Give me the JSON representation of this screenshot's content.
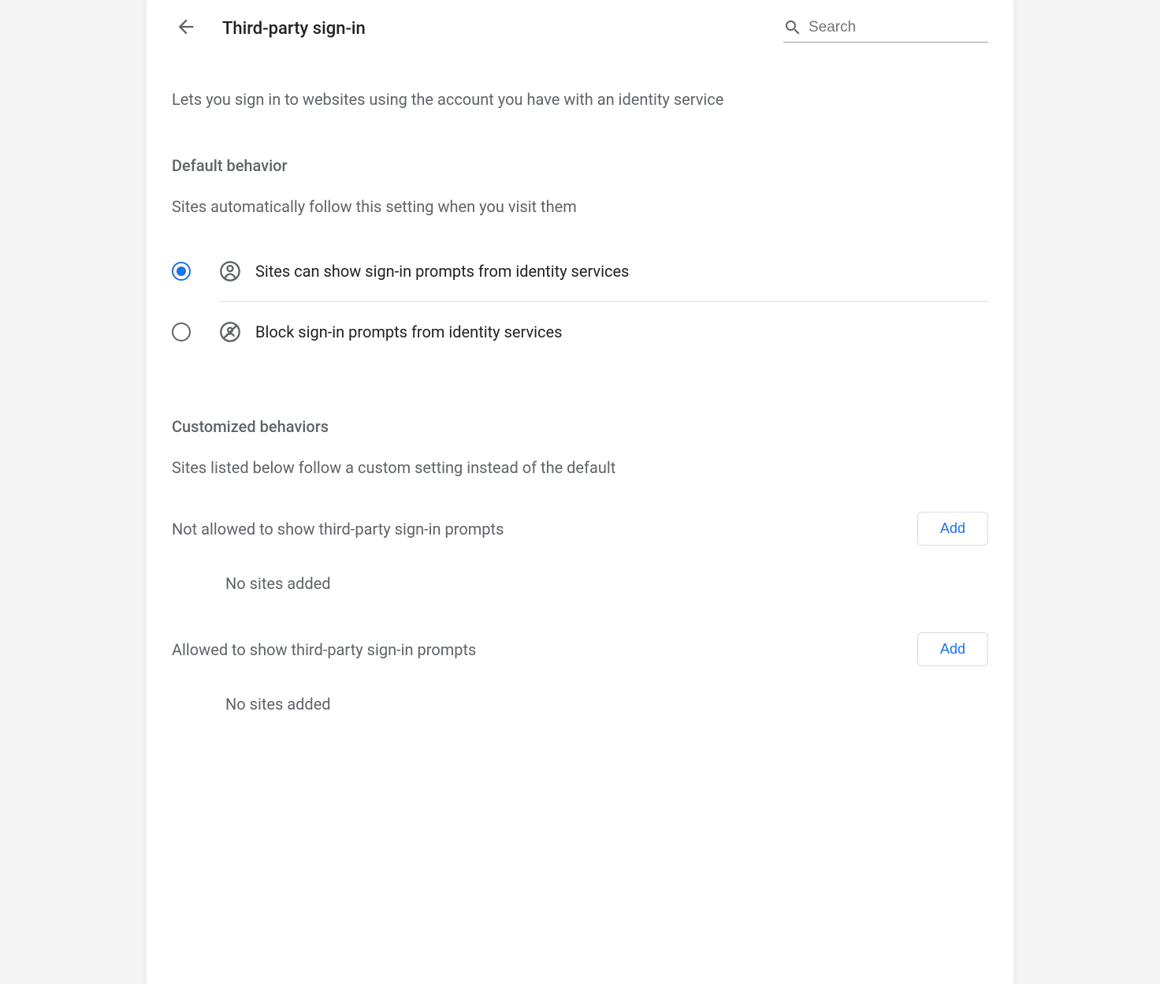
{
  "header": {
    "title": "Third-party sign-in",
    "search_placeholder": "Search"
  },
  "description": "Lets you sign in to websites using the account you have with an identity service",
  "default_behavior": {
    "title": "Default behavior",
    "subtitle": "Sites automatically follow this setting when you visit them",
    "options": [
      {
        "label": "Sites can show sign-in prompts from identity services",
        "selected": true
      },
      {
        "label": "Block sign-in prompts from identity services",
        "selected": false
      }
    ]
  },
  "customized_behaviors": {
    "title": "Customized behaviors",
    "subtitle": "Sites listed below follow a custom setting instead of the default",
    "sections": [
      {
        "label": "Not allowed to show third-party sign-in prompts",
        "button": "Add",
        "empty": "No sites added"
      },
      {
        "label": "Allowed to show third-party sign-in prompts",
        "button": "Add",
        "empty": "No sites added"
      }
    ]
  }
}
